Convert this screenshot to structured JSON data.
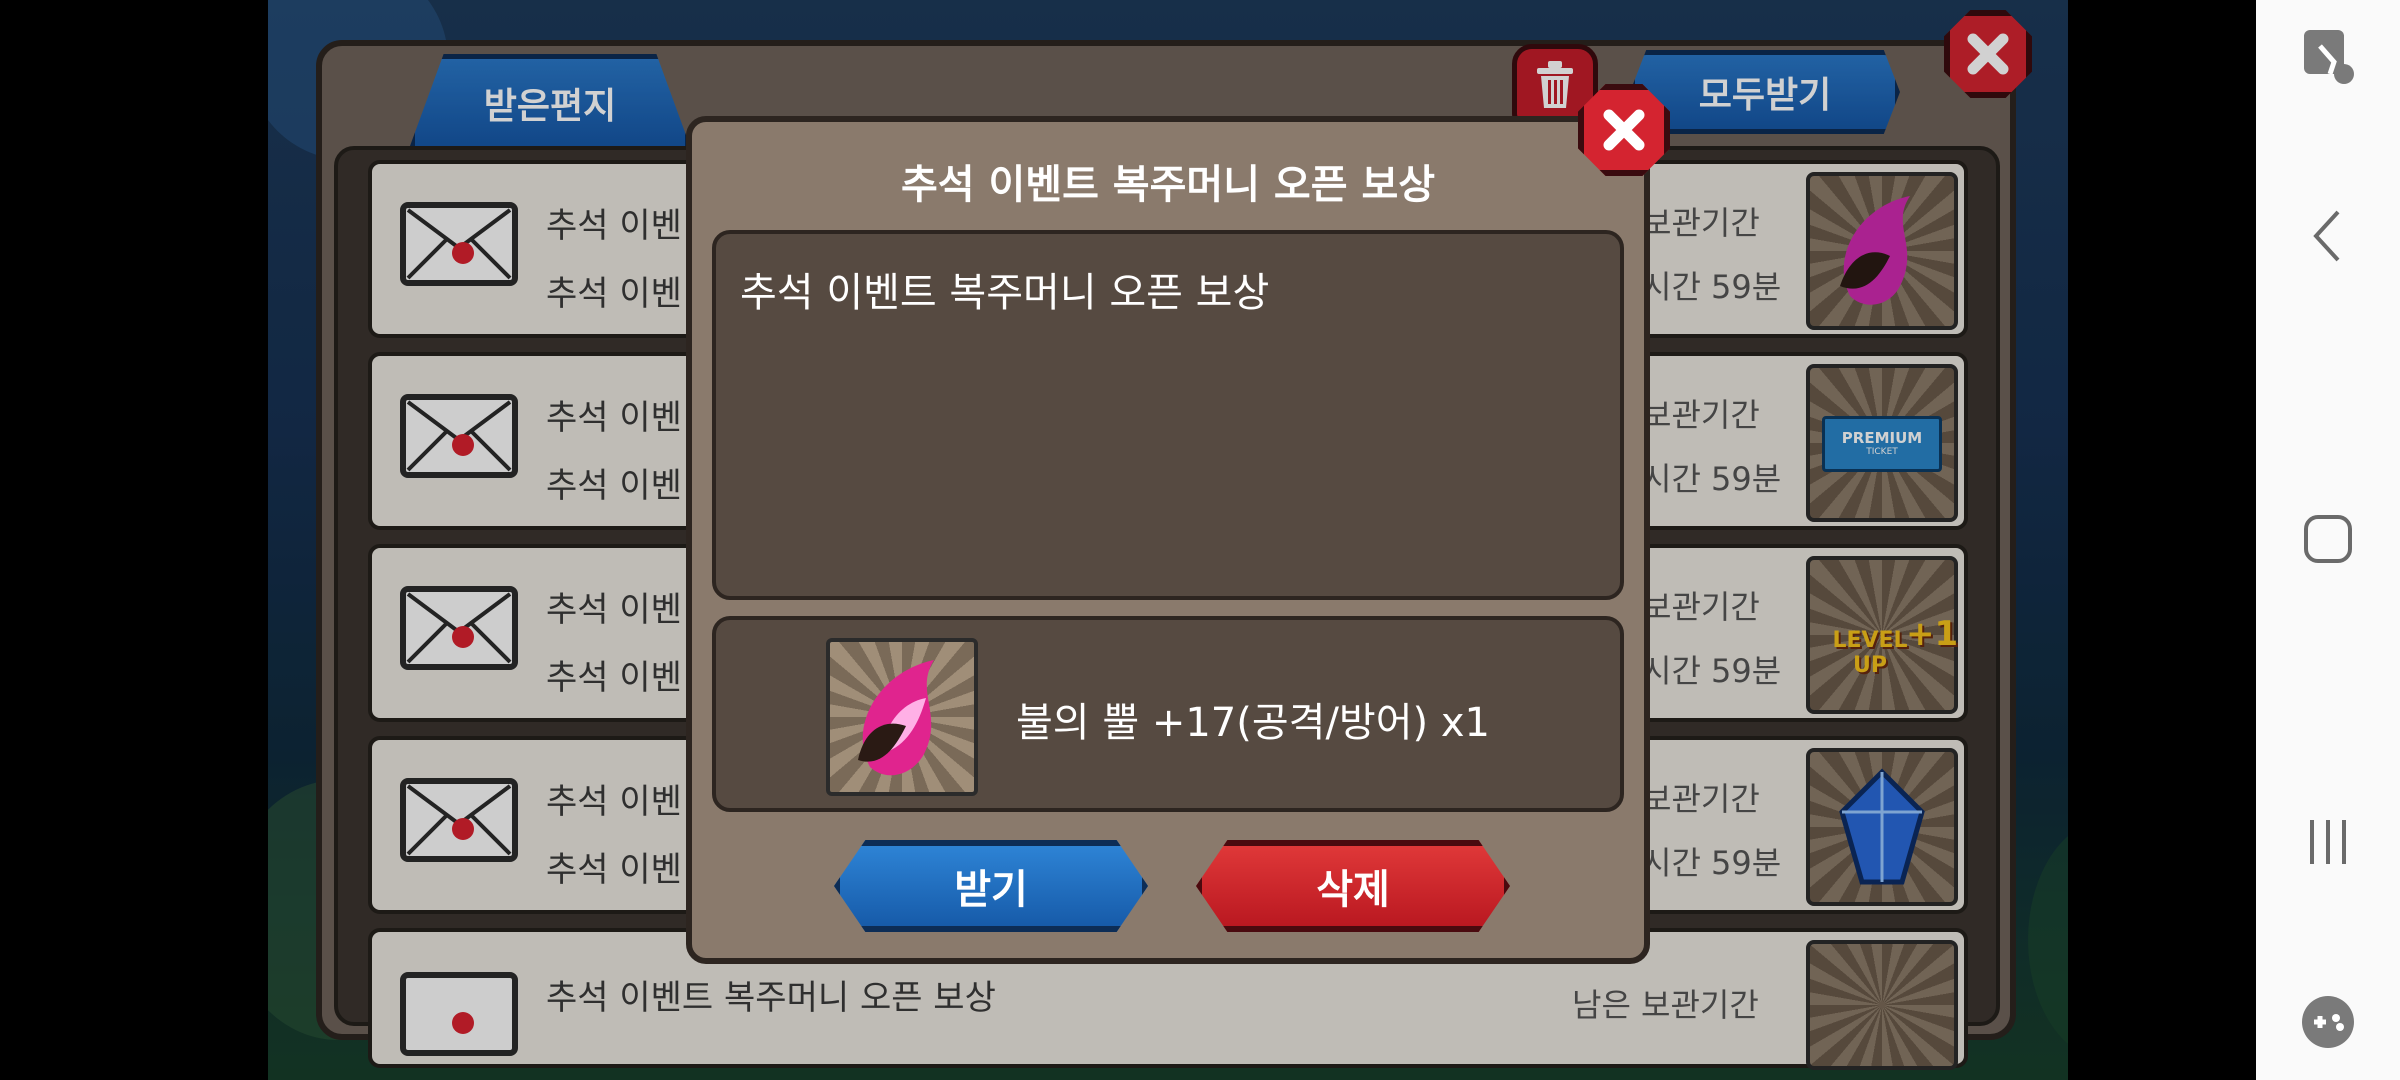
{
  "mailbox": {
    "tab_received": "받은편지",
    "receive_all": "모두받기",
    "rows": [
      {
        "title": "추석 이벤",
        "subtitle": "추석 이벤",
        "expire": "보관기간",
        "remain": "시간 59분",
        "item": "fire-horn"
      },
      {
        "title": "추석 이벤",
        "subtitle": "추석 이벤",
        "expire": "보관기간",
        "remain": "시간 59분",
        "item": "premium-ticket"
      },
      {
        "title": "추석 이벤",
        "subtitle": "추석 이벤",
        "expire": "보관기간",
        "remain": "시간 59분",
        "item": "level-up"
      },
      {
        "title": "추석 이벤",
        "subtitle": "추석 이벤",
        "expire": "보관기간",
        "remain": "시간 59분",
        "item": "blue-gem"
      },
      {
        "title": "추석 이벤트 복주머니 오픈 보상",
        "subtitle": "",
        "expire": "남은 보관기간",
        "remain": "",
        "item": "coin-pouch"
      }
    ],
    "ticket_text": "PREMIUM",
    "ticket_sub": "TICKET",
    "level_text": "LEVEL UP",
    "level_num": "+1"
  },
  "modal": {
    "title": "추석 이벤트 복주머니 오픈 보상",
    "body": "추석 이벤트 복주머니 오픈 보상",
    "item_label": "불의 뿔 +17(공격/방어) x1",
    "receive_button": "받기",
    "delete_button": "삭제"
  },
  "colors": {
    "blue": "#1657a6",
    "red": "#c41d2a",
    "panel": "#8a7a6c",
    "inner": "#564a41"
  }
}
